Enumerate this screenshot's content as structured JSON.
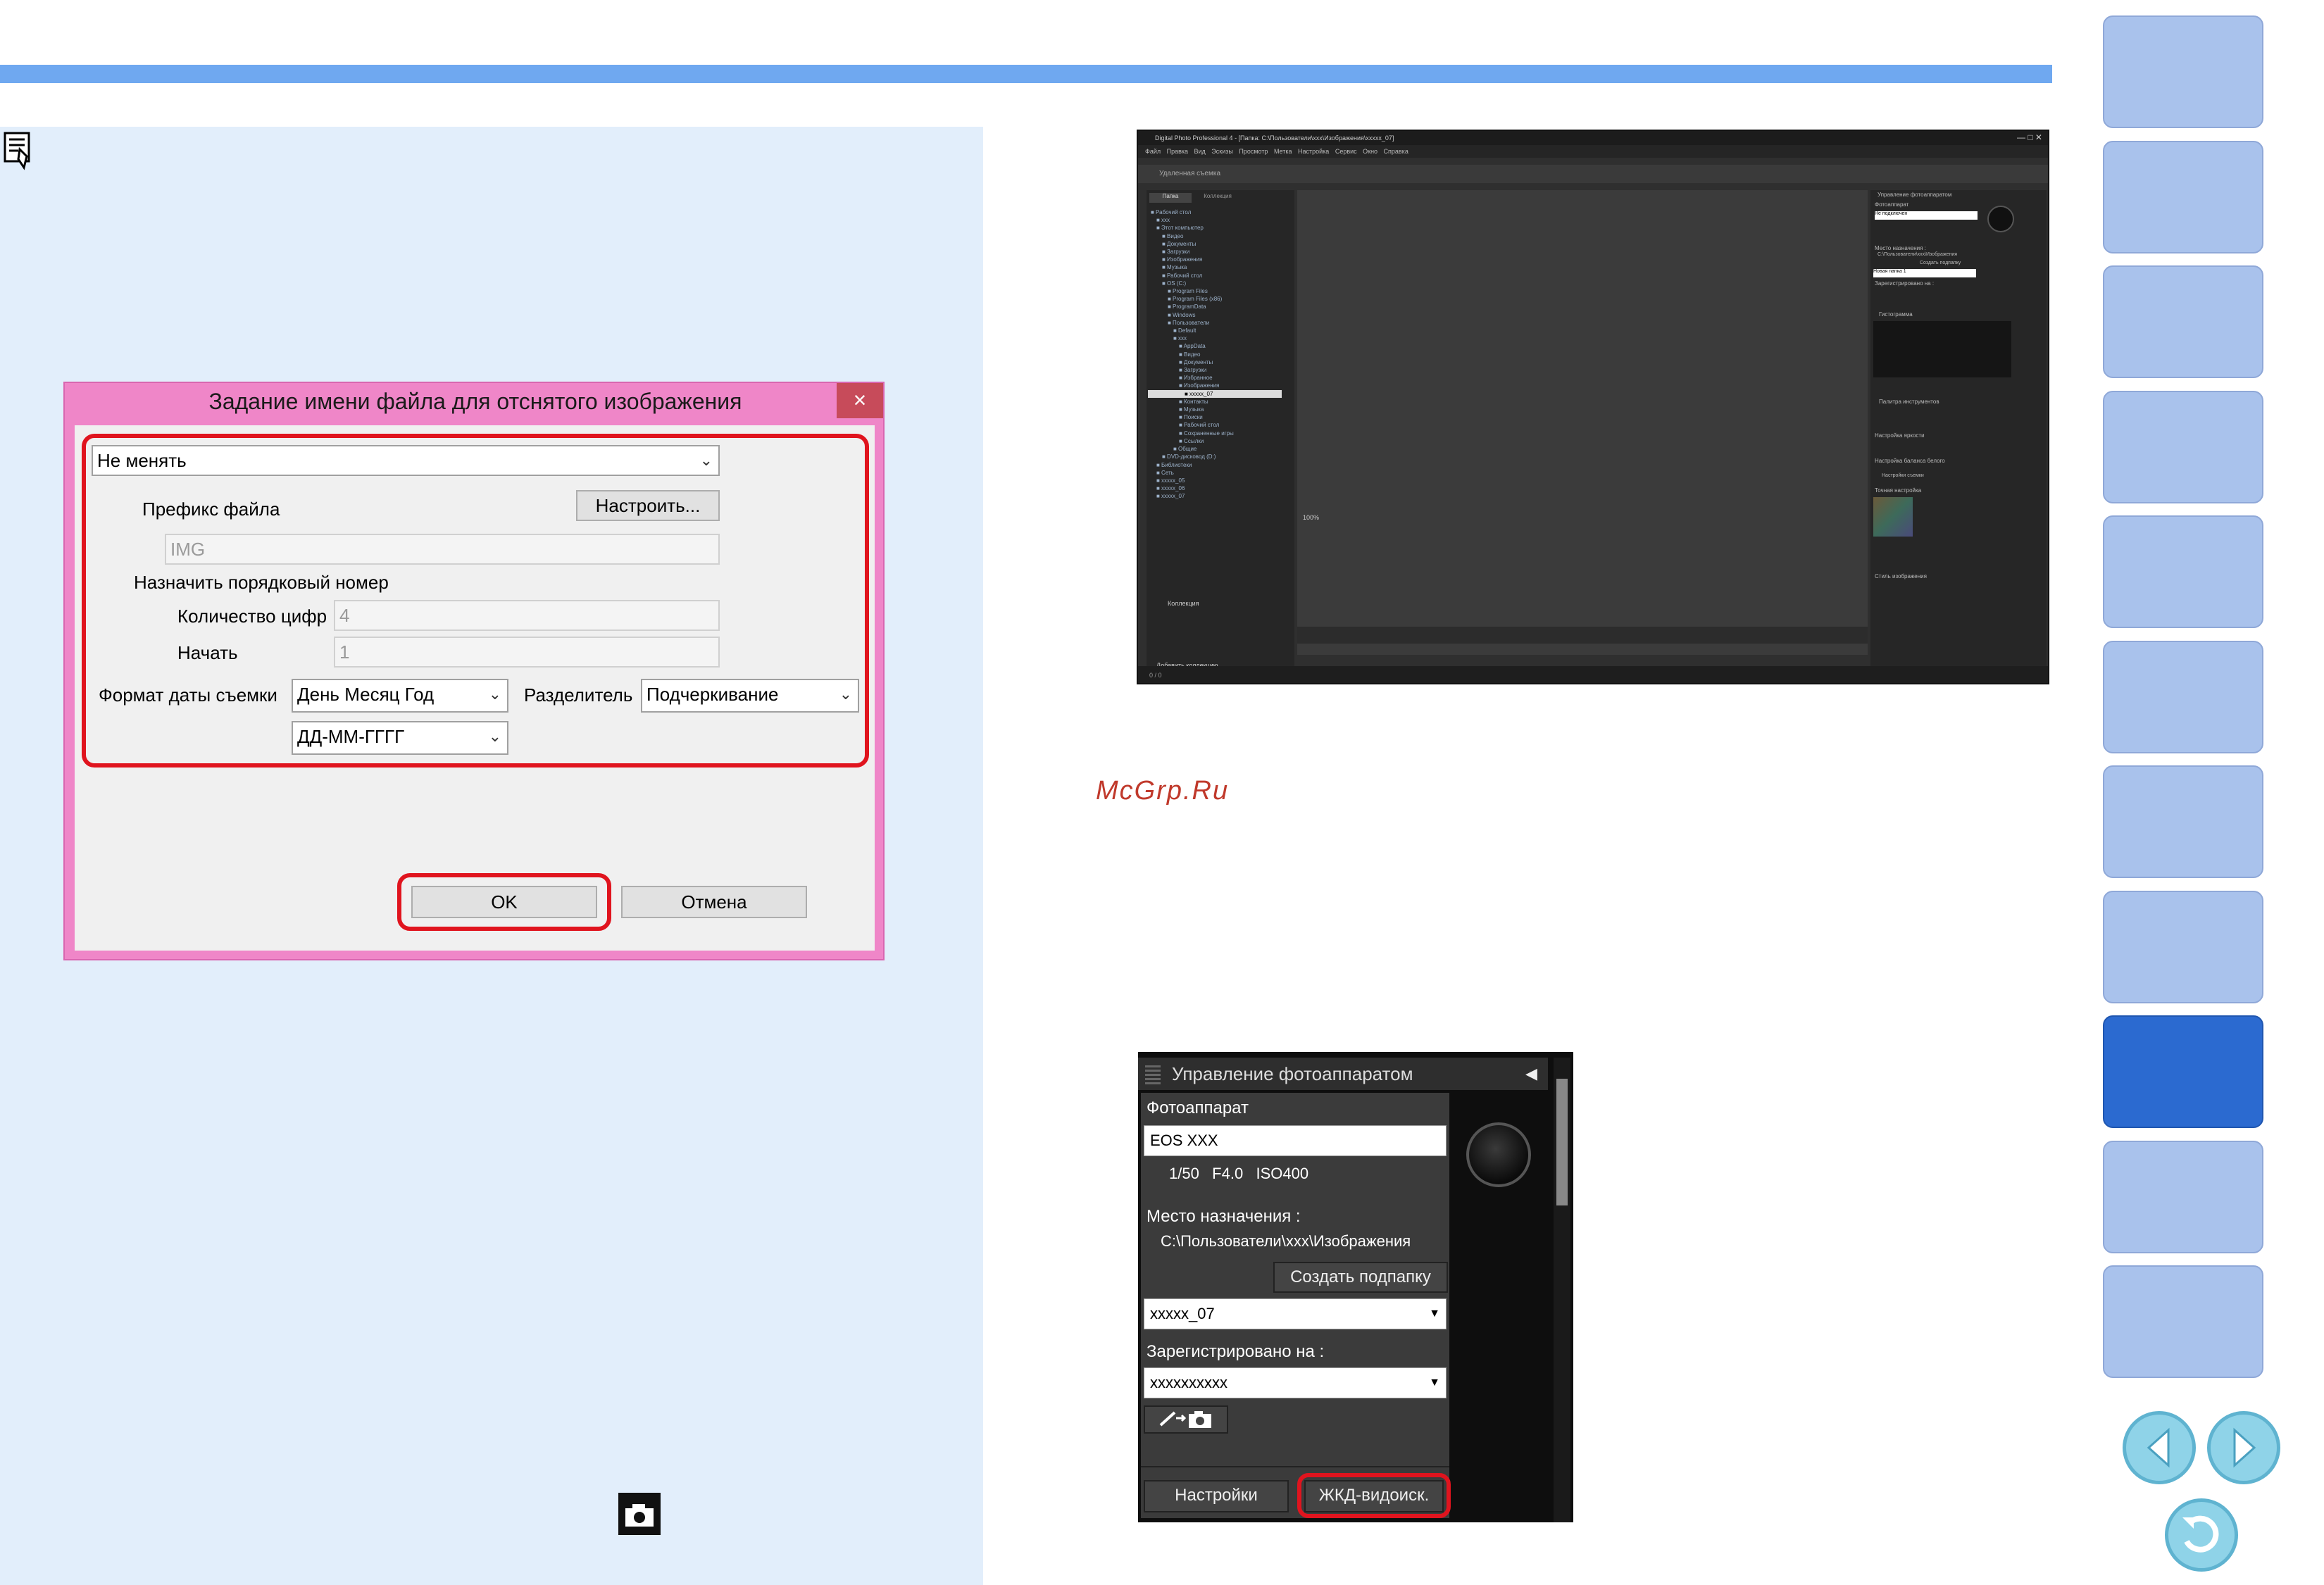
{
  "watermark": "McGrp.Ru",
  "dialog": {
    "title": "Задание имени файла для отснятого изображения",
    "close_label": "×",
    "naming_select": "Не менять",
    "prefix_label": "Префикс файла",
    "configure_button": "Настроить...",
    "prefix_value": "IMG",
    "sequence_label": "Назначить порядковый номер",
    "digits_label": "Количество цифр",
    "digits_value": "4",
    "start_label": "Начать",
    "start_value": "1",
    "date_format_label": "Формат даты съемки",
    "date_order_select": "День Месяц Год",
    "separator_label": "Разделитель",
    "separator_select": "Подчеркивание",
    "date_pattern_select": "ДД-ММ-ГГГГ",
    "ok_button": "OK",
    "cancel_button": "Отмена"
  },
  "dpp": {
    "title": "Digital Photo Professional 4 - [Папка: C:\\Пользователи\\xxx\\Изображения\\xxxxx_07]",
    "menu": "Файл Правка Вид Эскизы Просмотр Метка Настройка Сервис Окно Справка",
    "toolbar": "Удаленная съемка",
    "tabs": [
      "Папка",
      "Коллекция"
    ],
    "tree": [
      "Рабочий стол",
      "xxx",
      "Этот компьютер",
      "Видео",
      "Документы",
      "Загрузки",
      "Изображения",
      "Музыка",
      "Рабочий стол",
      "OS (C:)",
      "Program Files",
      "Program Files (x86)",
      "ProgramData",
      "Windows",
      "Пользователи",
      "Default",
      "xxx",
      "AppData",
      "Видео",
      "Документы",
      "Загрузки",
      "Избранное",
      "Изображения",
      "xxxxx_07",
      "Контакты",
      "Музыка",
      "Поиски",
      "Рабочий стол",
      "Сохраненные игры",
      "Ссылки",
      "Общие",
      "DVD-дисковод (D:)",
      "Библиотеки",
      "Сеть",
      "xxxxx_05",
      "xxxxx_06",
      "xxxxx_07"
    ],
    "collection_label": "Коллекция",
    "add_collection": "Добавить коллекцию",
    "zoom": "100%",
    "status_left": "0 / 0",
    "right_panel_title": "Управление фотоаппаратом",
    "right_camera_label": "Фотоаппарат",
    "right_camera_value": "Не подключен",
    "right_dest_label": "Место назначения :",
    "right_dest_path": "C:\\Пользователи\\xxx\\Изображения",
    "right_create_folder": "Создать подпапку",
    "right_folder_value": "Новая папка 1",
    "right_registered": "Зарегистрировано на :",
    "histogram_label": "Гистограмма",
    "tool_palette_label": "Палитра инструментов",
    "brightness_label": "Настройка яркости",
    "wb_label": "Настройка баланса белого",
    "shot_settings": "Настройки съемки",
    "fine_tune_label": "Точная настройка",
    "picture_style_label": "Стиль изображения"
  },
  "camera_panel": {
    "header": "Управление фотоаппаратом",
    "camera_label": "Фотоаппарат",
    "camera_value": "EOS XXX",
    "exposure": "1/50   F4.0   ISO400",
    "dest_label": "Место назначения :",
    "dest_path": "C:\\Пользователи\\xxx\\Изображения",
    "create_subfolder": "Создать подпапку",
    "folder_value": "xxxxx_07",
    "registered_label": "Зарегистрировано на :",
    "registered_value": "xxxxxxxxxx",
    "settings_button": "Настройки",
    "live_view_button": "ЖКД-видоиск."
  },
  "nav": {
    "active_index": 8,
    "tab_count": 11,
    "accent": "#2b6ad0"
  },
  "colors": {
    "highlight": "#e0141e",
    "dialog_frame": "#ef86c8",
    "note_background": "#e2eefb",
    "top_rule": "#6fa8f0"
  }
}
